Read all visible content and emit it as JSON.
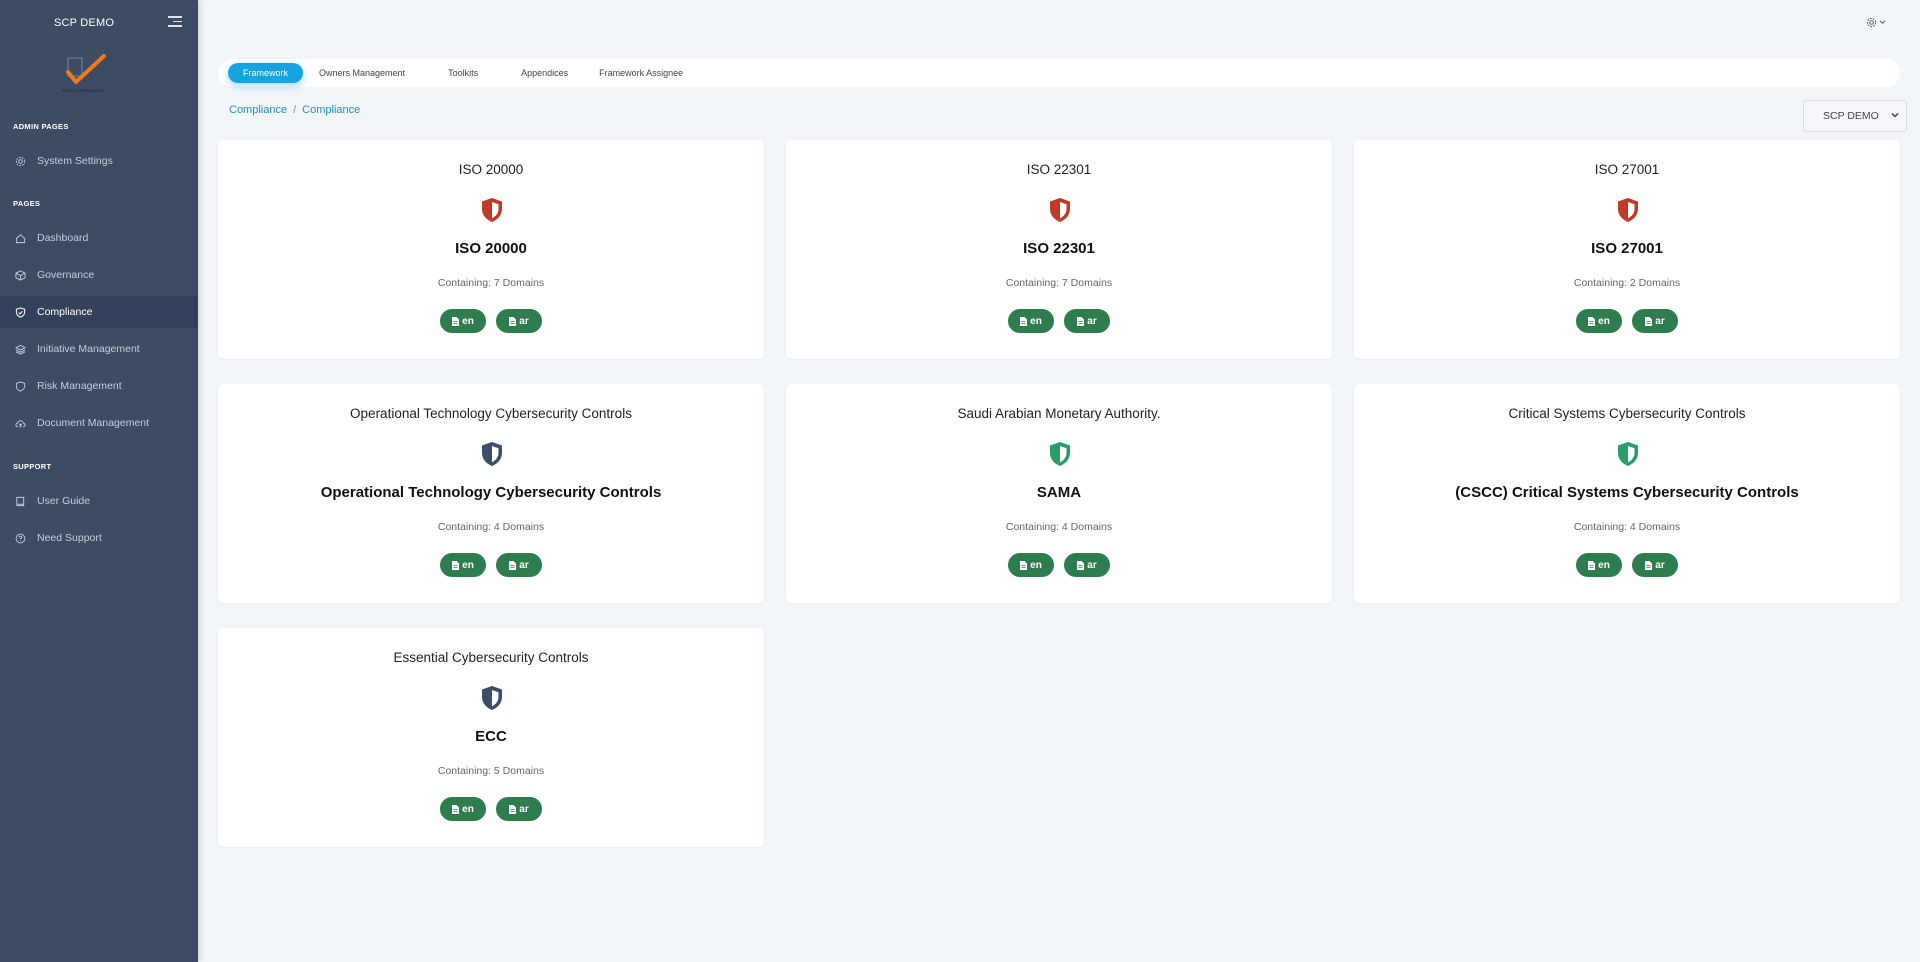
{
  "sidebar": {
    "title": "SCP DEMO",
    "logo_text": "SAFE COMPLIANCE",
    "sections": {
      "admin": "ADMIN PAGES",
      "pages": "PAGES",
      "support": "SUPPORT"
    },
    "items": [
      {
        "label": "System Settings",
        "icon": "gear-icon"
      },
      {
        "label": "Dashboard",
        "icon": "home-icon"
      },
      {
        "label": "Governance",
        "icon": "box-icon"
      },
      {
        "label": "Compliance",
        "icon": "shield-check-icon",
        "active": true
      },
      {
        "label": "Initiative Management",
        "icon": "layers-icon"
      },
      {
        "label": "Risk Management",
        "icon": "shield-icon"
      },
      {
        "label": "Document Management",
        "icon": "cloud-upload-icon"
      },
      {
        "label": "User Guide",
        "icon": "book-icon"
      },
      {
        "label": "Need Support",
        "icon": "help-circle-icon"
      }
    ]
  },
  "tabs": [
    {
      "label": "Framework",
      "active": true
    },
    {
      "label": "Owners Management"
    },
    {
      "label": "Toolkits"
    },
    {
      "label": "Appendices"
    },
    {
      "label": "Framework Assignee"
    }
  ],
  "breadcrumb": [
    "Compliance",
    "Compliance"
  ],
  "org_select": {
    "value": "SCP DEMO"
  },
  "colors": {
    "sidebar_bg": "#3d4b63",
    "accent": "#16a3e0",
    "pill_green": "#2e7d4e",
    "shield_red": "#c0392b",
    "shield_navy": "#3b4d6b",
    "shield_green": "#2a9d6a"
  },
  "cards": [
    {
      "title": "ISO 20000",
      "name": "ISO 20000",
      "count": "Containing: 7 Domains",
      "shield": "red",
      "btn_en": "en",
      "btn_ar": "ar"
    },
    {
      "title": "ISO 22301",
      "name": "ISO 22301",
      "count": "Containing: 7 Domains",
      "shield": "red",
      "btn_en": "en",
      "btn_ar": "ar"
    },
    {
      "title": "ISO 27001",
      "name": "ISO 27001",
      "count": "Containing: 2 Domains",
      "shield": "red",
      "btn_en": "en",
      "btn_ar": "ar"
    },
    {
      "title": "Operational Technology Cybersecurity Controls",
      "name": "Operational Technology Cybersecurity Controls",
      "count": "Containing: 4 Domains",
      "shield": "navy",
      "btn_en": "en",
      "btn_ar": "ar"
    },
    {
      "title": "Saudi Arabian Monetary Authority.",
      "name": "SAMA",
      "count": "Containing: 4 Domains",
      "shield": "green",
      "btn_en": "en",
      "btn_ar": "ar"
    },
    {
      "title": "Critical Systems Cybersecurity Controls",
      "name": "(CSCC) Critical Systems Cybersecurity Controls",
      "count": "Containing: 4 Domains",
      "shield": "green",
      "btn_en": "en",
      "btn_ar": "ar"
    },
    {
      "title": "Essential Cybersecurity Controls",
      "name": "ECC",
      "count": "Containing: 5 Domains",
      "shield": "navy",
      "btn_en": "en",
      "btn_ar": "ar"
    }
  ]
}
